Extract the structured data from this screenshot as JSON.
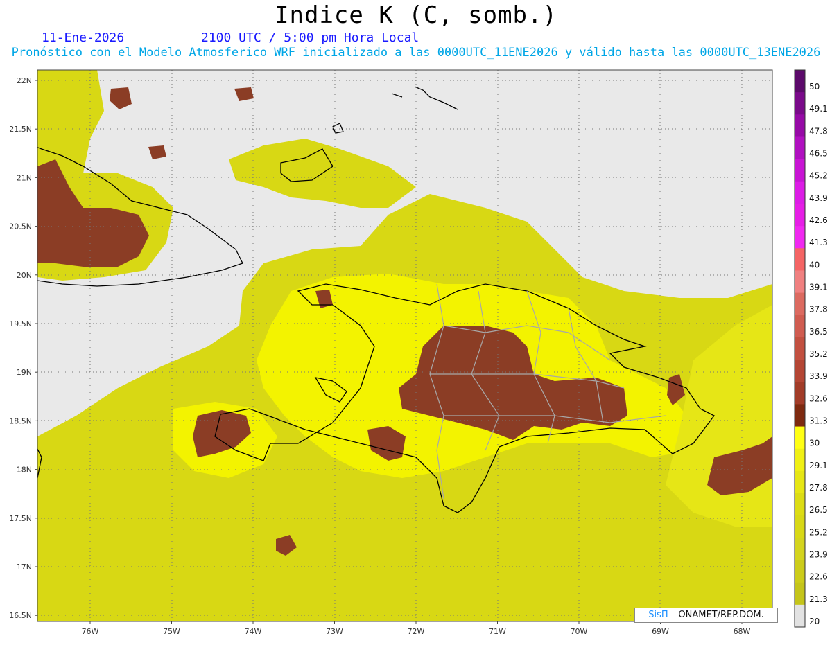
{
  "header": {
    "title": "Indice K (C, somb.)",
    "date": "11-Ene-2026",
    "time": "2100 UTC / 5:00 pm Hora Local",
    "forecast_note": "Pronóstico con el Modelo Atmosferico WRF inicializado a las 0000UTC_11ENE2026 y válido hasta las  0000UTC_13ENE2026"
  },
  "map": {
    "lat_labels": [
      "22N",
      "21.5N",
      "21N",
      "20.5N",
      "20N",
      "19.5N",
      "19N",
      "18.5N",
      "18N",
      "17.5N",
      "17N",
      "16.5N"
    ],
    "lon_labels": [
      "76W",
      "75W",
      "74W",
      "73W",
      "72W",
      "71W",
      "70W",
      "69W",
      "68W"
    ],
    "colors": {
      "land_bg": "#e9e9e9",
      "yellow": "#f3f300",
      "olive": "#d4d411",
      "brown": "#8b3d25",
      "coast": "#000000",
      "provinces": "#a8a8a8"
    }
  },
  "colorbar": {
    "labels": [
      "50",
      "49.1",
      "47.8",
      "46.5",
      "45.2",
      "43.9",
      "42.6",
      "41.3",
      "40",
      "39.1",
      "37.8",
      "36.5",
      "35.2",
      "33.9",
      "32.6",
      "31.3",
      "30",
      "29.1",
      "27.8",
      "26.5",
      "25.2",
      "23.9",
      "22.6",
      "21.3",
      "20"
    ],
    "colors": [
      "#5c0a6b",
      "#7a0a8a",
      "#960aa6",
      "#b010c0",
      "#c814d4",
      "#dc1ce6",
      "#e61ee6",
      "#f028f0",
      "#f46464",
      "#f08080",
      "#dc6a60",
      "#d05c50",
      "#c25040",
      "#b44634",
      "#a23c28",
      "#7e2a10",
      "#ffff14",
      "#f0f014",
      "#e6e614",
      "#dcdc14",
      "#d8d816",
      "#d4d41e",
      "#cccc1a",
      "#c4c41a",
      "#e2e2e2"
    ]
  },
  "credit": {
    "brand": "SisΠ",
    "text": " – ONAMET/REP.DOM."
  }
}
